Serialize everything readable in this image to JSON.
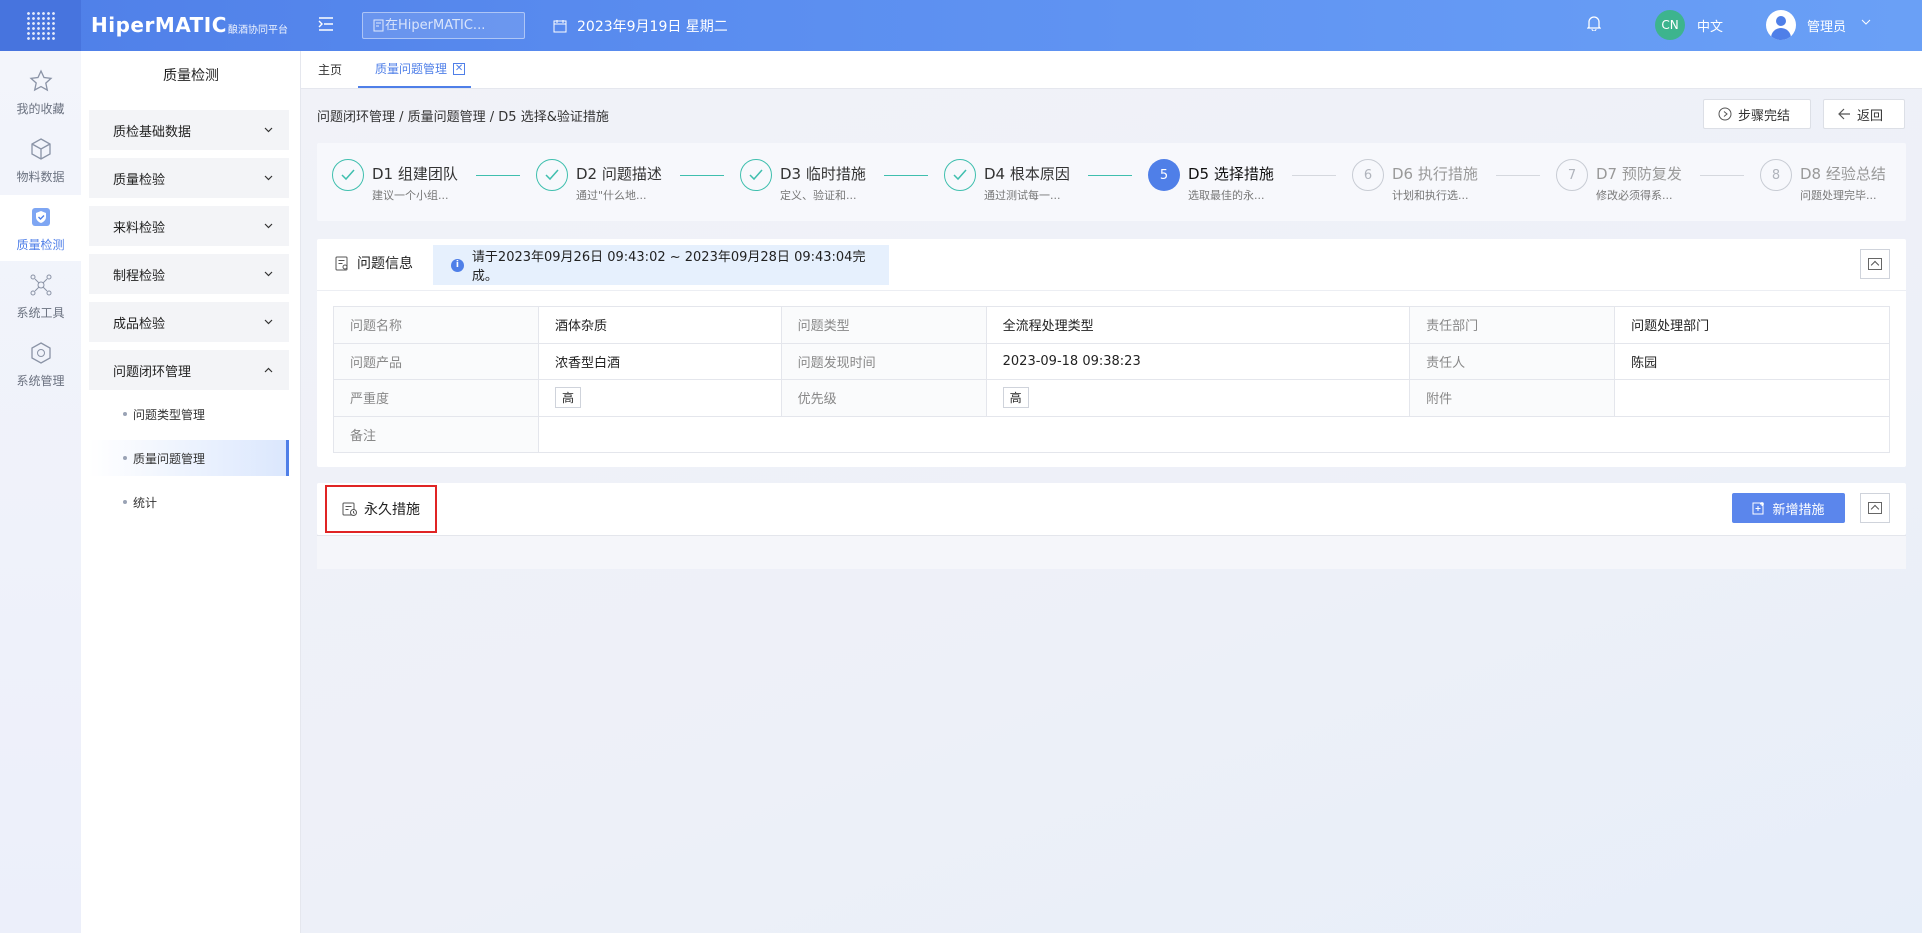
{
  "header": {
    "brand": "HiperMATIC",
    "brand_sub": "酿酒协同平台",
    "search_placeholder": "在HiperMATIC...",
    "date": "2023年9月19日 星期二",
    "lang_badge": "CN",
    "lang": "中文",
    "user": "管理员"
  },
  "rail": [
    {
      "label": "我的收藏",
      "icon": "star-icon"
    },
    {
      "label": "物料数据",
      "icon": "cube-icon"
    },
    {
      "label": "质量检测",
      "icon": "shield-check-icon",
      "active": true
    },
    {
      "label": "系统工具",
      "icon": "network-icon"
    },
    {
      "label": "系统管理",
      "icon": "gear-cube-icon"
    }
  ],
  "sidebar": {
    "title": "质量检测",
    "groups": [
      {
        "label": "质检基础数据"
      },
      {
        "label": "质量检验"
      },
      {
        "label": "来料检验"
      },
      {
        "label": "制程检验"
      },
      {
        "label": "成品检验"
      },
      {
        "label": "问题闭环管理"
      }
    ],
    "subs": [
      {
        "label": "问题类型管理"
      },
      {
        "label": "质量问题管理",
        "active": true
      },
      {
        "label": "统计"
      }
    ]
  },
  "tabs": [
    {
      "label": "主页"
    },
    {
      "label": "质量问题管理",
      "active": true
    }
  ],
  "breadcrumb": "问题闭环管理 / 质量问题管理 / D5 选择&验证措施",
  "actions": {
    "complete": "步骤完结",
    "back": "返回"
  },
  "steps": [
    {
      "num": "1",
      "title": "D1 组建团队",
      "desc": "建议一个小组...",
      "state": "done"
    },
    {
      "num": "2",
      "title": "D2 问题描述",
      "desc": "通过\"什么地...",
      "state": "done"
    },
    {
      "num": "3",
      "title": "D3 临时措施",
      "desc": "定义、验证和...",
      "state": "done"
    },
    {
      "num": "4",
      "title": "D4 根本原因",
      "desc": "通过测试每一...",
      "state": "done"
    },
    {
      "num": "5",
      "title": "D5 选择措施",
      "desc": "选取最佳的永...",
      "state": "current"
    },
    {
      "num": "6",
      "title": "D6 执行措施",
      "desc": "计划和执行选...",
      "state": "todo"
    },
    {
      "num": "7",
      "title": "D7 预防复发",
      "desc": "修改必须得系...",
      "state": "todo"
    },
    {
      "num": "8",
      "title": "D8 经验总结",
      "desc": "问题处理完毕...",
      "state": "todo"
    }
  ],
  "info": {
    "title": "问题信息",
    "notice": "请于2023年09月26日 09:43:02 ~ 2023年09月28日 09:43:04完成。",
    "rows": [
      [
        {
          "k": "问题名称",
          "v": "酒体杂质"
        },
        {
          "k": "问题类型",
          "v": "全流程处理类型"
        },
        {
          "k": "责任部门",
          "v": "问题处理部门"
        }
      ],
      [
        {
          "k": "问题产品",
          "v": "浓香型白酒"
        },
        {
          "k": "问题发现时间",
          "v": "2023-09-18 09:38:23"
        },
        {
          "k": "责任人",
          "v": "陈园"
        }
      ],
      [
        {
          "k": "严重度",
          "v": "高"
        },
        {
          "k": "优先级",
          "v": "高"
        },
        {
          "k": "附件",
          "v": ""
        }
      ]
    ],
    "remark_label": "备注",
    "remark_value": ""
  },
  "permanent": {
    "title": "永久措施",
    "add_button": "新增措施"
  },
  "colors": {
    "accent": "#4f7fe8",
    "done": "#3fbfae",
    "highlight_border": "#e02424"
  }
}
